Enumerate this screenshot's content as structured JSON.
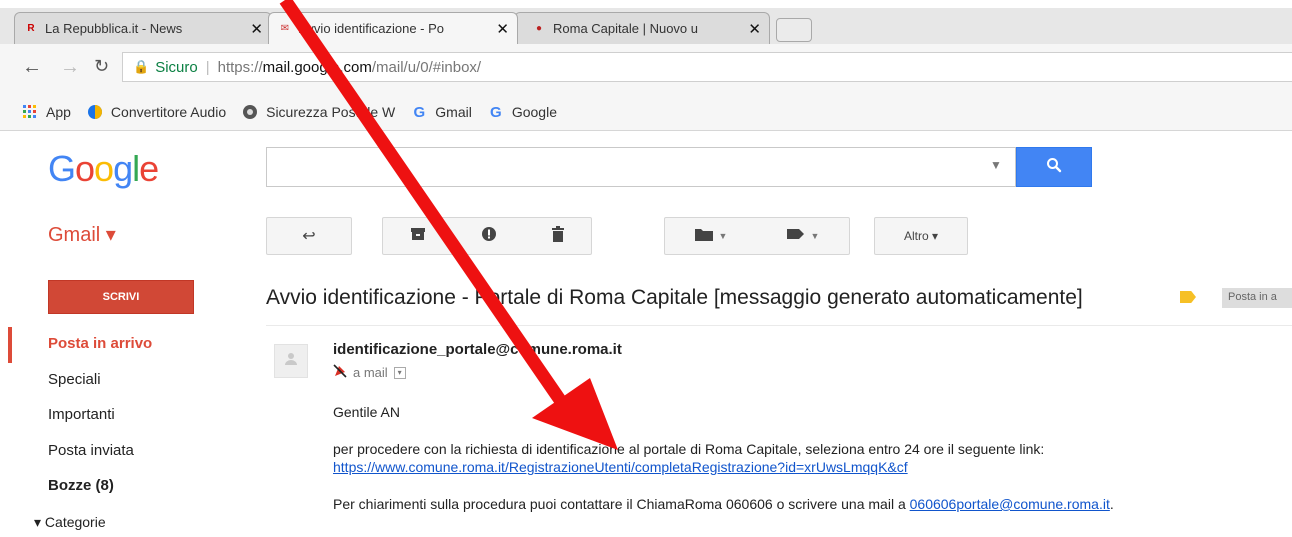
{
  "tabs": [
    {
      "title": "La Repubblica.it - News",
      "favicon": "R",
      "close": "✕"
    },
    {
      "title": "Avvio identificazione - Po",
      "favicon": "✉",
      "close": "✕"
    },
    {
      "title": "Roma Capitale | Nuovo u",
      "favicon": "●",
      "close": "✕"
    }
  ],
  "address": {
    "secure_label": "Sicuro",
    "url_proto": "https://",
    "url_host": "mail.google.com",
    "url_path": "/mail/u/0/#inbox/"
  },
  "bookmarks": [
    {
      "label": "App",
      "icon": "apps-grid-icon"
    },
    {
      "label": "Convertitore Audio",
      "icon": "circle-icon"
    },
    {
      "label": "Sicurezza Postale W",
      "icon": "shield-icon"
    },
    {
      "label": "Gmail",
      "icon": "google-icon"
    },
    {
      "label": "Google",
      "icon": "google-icon"
    }
  ],
  "header": {
    "logo": [
      "G",
      "o",
      "o",
      "g",
      "l",
      "e"
    ],
    "logo_colors": [
      "#4285f4",
      "#ea4335",
      "#fbbc05",
      "#4285f4",
      "#34a853",
      "#ea4335"
    ],
    "gmail_label": "Gmail ▾"
  },
  "toolbar": {
    "back_icon": "↩",
    "altro": "Altro ▾"
  },
  "sidebar": {
    "compose": "SCRIVI",
    "items": [
      "Posta in arrivo",
      "Speciali",
      "Importanti",
      "Posta inviata",
      "Bozze (8)",
      "▾ Categorie"
    ]
  },
  "message": {
    "subject": "Avvio identificazione - Portale di Roma Capitale [messaggio generato automaticamente]",
    "inbox_label": "Posta in a",
    "sender": "identificazione_portale@comune.roma.it",
    "recipient": "a mail",
    "greeting": "Gentile AN",
    "line1": "per procedere con la richiesta di identificazione al portale di Roma Capitale, seleziona entro 24 ore il seguente link:",
    "link": "https://www.comune.roma.it/RegistrazioneUtenti/completaRegistrazione?id=xrUwsLmqqK&cf",
    "line2_prefix": "Per chiarimenti sulla procedura puoi contattare il ChiamaRoma 060606 o scrivere una mail a ",
    "contact_link": "060606portale@comune.roma.it",
    "line2_suffix": "."
  },
  "colors": {
    "gmail_red": "#dd4b39",
    "compose_red": "#d14836",
    "search_blue": "#4285f4",
    "link_blue": "#1155cc",
    "arrow_red": "#ee1111"
  }
}
